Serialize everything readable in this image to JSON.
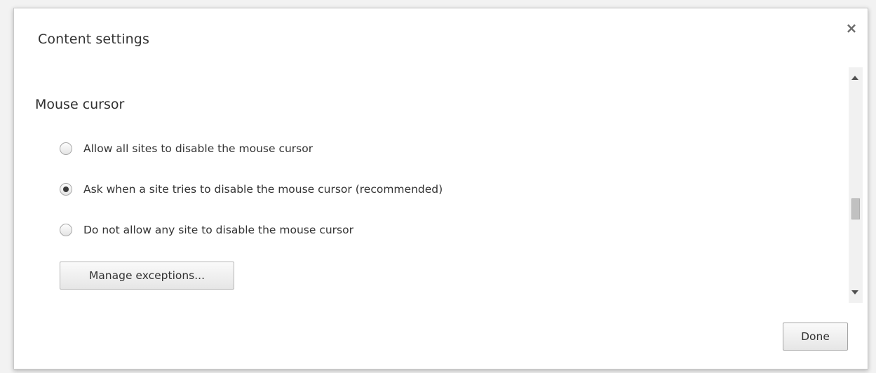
{
  "dialog": {
    "title": "Content settings",
    "close_symbol": "×"
  },
  "section": {
    "title": "Mouse cursor",
    "options": [
      {
        "label": "Allow all sites to disable the mouse cursor",
        "checked": false
      },
      {
        "label": "Ask when a site tries to disable the mouse cursor (recommended)",
        "checked": true
      },
      {
        "label": "Do not allow any site to disable the mouse cursor",
        "checked": false
      }
    ],
    "manage_button": "Manage exceptions..."
  },
  "footer": {
    "done_button": "Done"
  },
  "icons": {
    "close": "close-icon",
    "scroll_up": "scroll-up-arrow-icon",
    "scroll_down": "scroll-down-arrow-icon"
  },
  "colors": {
    "dialog_bg": "#ffffff",
    "text": "#333333",
    "backdrop": "#e9e9e9"
  }
}
